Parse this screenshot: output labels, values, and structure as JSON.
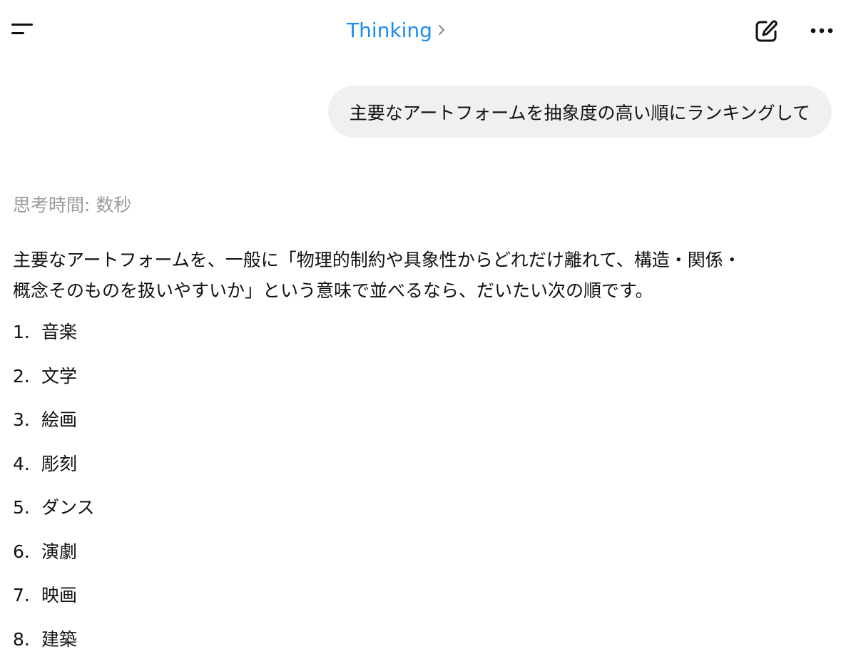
{
  "header": {
    "model_label": "Thinking",
    "icons": {
      "menu": "menu-icon",
      "chevron": "chevron-right-icon",
      "edit": "edit-icon",
      "more": "ellipsis-icon"
    },
    "accent_color": "#1a8cf0"
  },
  "conversation": {
    "user_message": "主要なアートフォームを抽象度の高い順にランキングして",
    "thought_time": "思考時間: 数秒",
    "intro_line1": "主要なアートフォームを、一般に「物理的制約や具象性からどれだけ離れて、構造・関係・",
    "intro_line2": "概念そのものを扱いやすいか」という意味で並べるなら、だいたい次の順です。",
    "ranking": [
      {
        "num": "1.",
        "label": "音楽"
      },
      {
        "num": "2.",
        "label": "文学"
      },
      {
        "num": "3.",
        "label": "絵画"
      },
      {
        "num": "4.",
        "label": "彫刻"
      },
      {
        "num": "5.",
        "label": "ダンス"
      },
      {
        "num": "6.",
        "label": "演劇"
      },
      {
        "num": "7.",
        "label": "映画"
      },
      {
        "num": "8.",
        "label": "建築"
      }
    ]
  }
}
